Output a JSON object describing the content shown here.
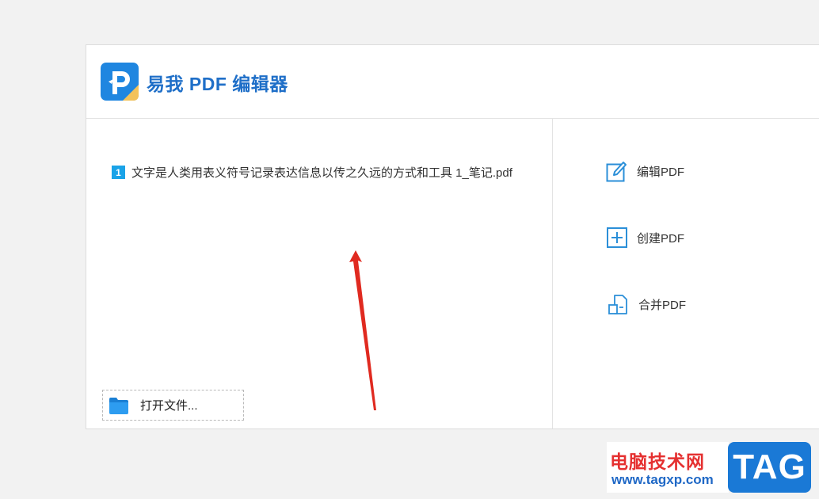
{
  "app": {
    "title": "易我 PDF 编辑器"
  },
  "recent_files": [
    {
      "number": "1",
      "name": "文字是人类用表义符号记录表达信息以传之久远的方式和工具 1_笔记.pdf"
    }
  ],
  "open_file": {
    "label": "打开文件..."
  },
  "actions": [
    {
      "label": "编辑PDF",
      "icon": "edit-pdf-icon"
    },
    {
      "label": "创建PDF",
      "icon": "plus-square-icon"
    },
    {
      "label": "合并PDF",
      "icon": "merge-pdf-icon"
    }
  ],
  "watermark": {
    "site_name": "电脑技术网",
    "url": "www.tagxp.com",
    "tag": "TAG"
  },
  "colors": {
    "brand_blue": "#1f6fc8",
    "accent_cyan": "#1aa3e8",
    "arrow_red": "#e02a20"
  }
}
